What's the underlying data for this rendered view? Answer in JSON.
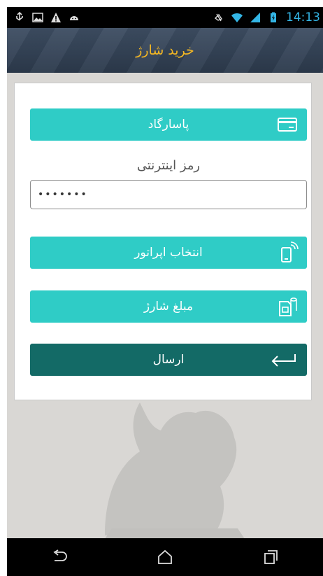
{
  "status_bar": {
    "time": "14:13",
    "left_icons": [
      "usb-icon",
      "image-icon",
      "warning-icon",
      "android-icon"
    ],
    "right_icons": [
      "mute-icon",
      "wifi-icon",
      "signal-icon",
      "battery-icon"
    ]
  },
  "header": {
    "title": "خرید شارژ"
  },
  "form": {
    "bank_button": {
      "label": "پاسارگاد",
      "icon": "card-icon"
    },
    "password_label": "رمز اینترنتی",
    "password_value": "•••••••",
    "operator_button": {
      "label": "انتخاب اپراتور",
      "icon": "phone-icon"
    },
    "amount_button": {
      "label": "مبلغ شارژ",
      "icon": "sim-coins-icon"
    },
    "send_button": {
      "label": "ارسال",
      "icon": "return-arrow-icon"
    }
  },
  "nav_bar": {
    "icons": [
      "back-icon",
      "home-icon",
      "recents-icon"
    ]
  },
  "colors": {
    "header": "#34445a",
    "title": "#f2b623",
    "button": "#2fccc6",
    "send": "#136a66"
  }
}
